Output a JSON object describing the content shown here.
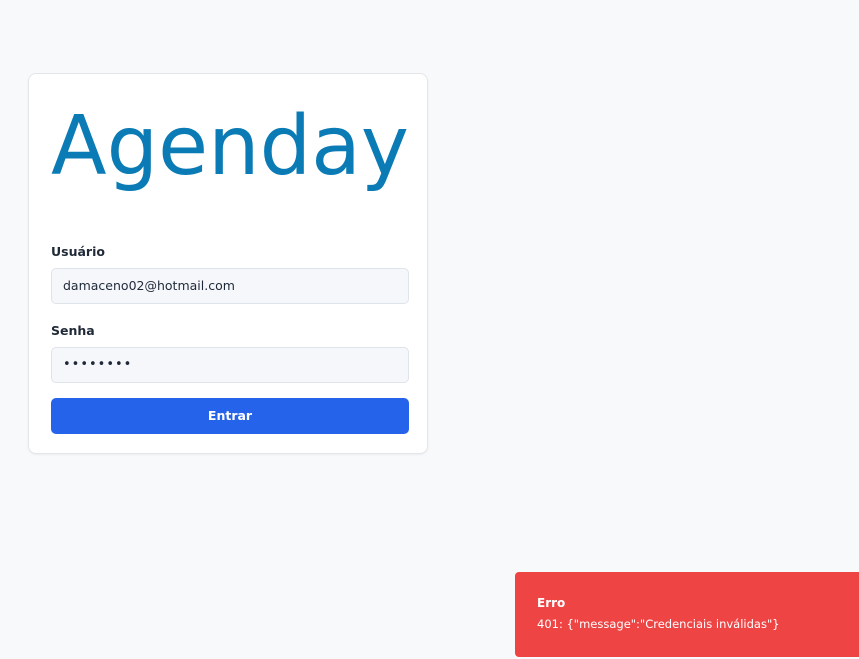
{
  "brand": {
    "name": "Agenday",
    "color": "#0b7bb5"
  },
  "login": {
    "username_label": "Usuário",
    "username_value": "damaceno02@hotmail.com",
    "password_label": "Senha",
    "password_value": "••••••••",
    "submit_label": "Entrar",
    "button_color": "#2563eb"
  },
  "toast": {
    "title": "Erro",
    "message": "401: {\"message\":\"Credenciais inválidas\"}",
    "color": "#ef4444"
  }
}
